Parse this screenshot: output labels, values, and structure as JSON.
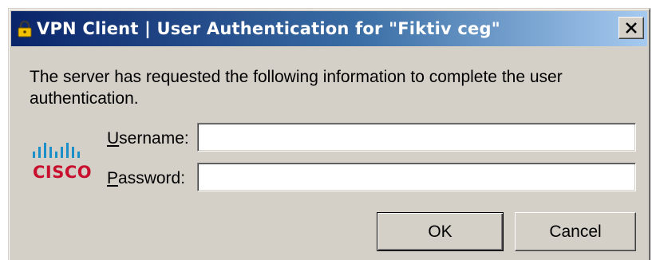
{
  "window": {
    "title": "VPN Client  |  User Authentication for \"Fiktiv ceg\""
  },
  "message": "The server has requested the following information to complete the user authentication.",
  "logo": {
    "brand": "CISCO",
    "brand_color": "#c8102e"
  },
  "fields": {
    "username": {
      "label_accel": "U",
      "label_rest": "sername:",
      "value": ""
    },
    "password": {
      "label_accel": "P",
      "label_rest": "assword:",
      "value": ""
    }
  },
  "buttons": {
    "ok": "OK",
    "cancel": "Cancel"
  },
  "icons": {
    "title": "lock-icon",
    "close": "close-icon"
  },
  "colors": {
    "title_start": "#0a246a",
    "title_end": "#a6caf0",
    "dialog_bg": "#d4d0c8"
  }
}
